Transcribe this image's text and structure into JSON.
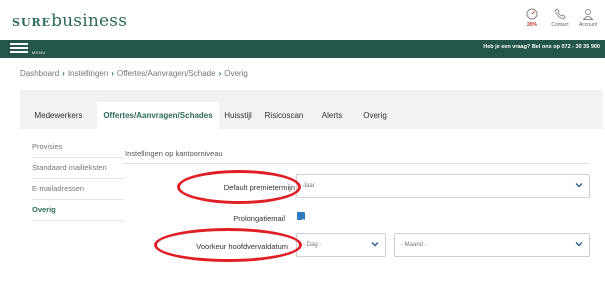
{
  "app": {
    "logo_prefix": "SURE",
    "logo_suffix": "business"
  },
  "toolbar": {
    "alerts": {
      "icon": "gauge-icon",
      "count": "20%"
    },
    "contact": {
      "icon": "phone-icon",
      "label": "Contact"
    },
    "account": {
      "icon": "user-icon",
      "label": "Account"
    }
  },
  "navbar": {
    "menu_label": "MENU",
    "help_text": "Heb je een vraag? Bel ons op 072 - 30 35 900"
  },
  "breadcrumb": [
    "Dashboard",
    "Instellingen",
    "Offertes/Aanvragen/Schade",
    "Overig"
  ],
  "tabs": [
    {
      "label": "Medewerkers",
      "active": false
    },
    {
      "label": "Offertes/Aanvragen/Schades",
      "active": true
    },
    {
      "label": "Huisstijl",
      "active": false
    },
    {
      "label": "Risicoscan",
      "active": false
    },
    {
      "label": "Alerts",
      "active": false
    },
    {
      "label": "Overig",
      "active": false
    }
  ],
  "sidebar": {
    "items": [
      {
        "label": "Provisies",
        "active": false
      },
      {
        "label": "Standaard mailteksten",
        "active": false
      },
      {
        "label": "E-mailadressen",
        "active": false
      },
      {
        "label": "Overig",
        "active": true
      }
    ]
  },
  "form": {
    "section_title": "Instellingen op kantoorniveau",
    "premietermijn": {
      "label": "Default premietermijn",
      "value": "Jaar"
    },
    "prolongatiemail": {
      "label": "Prolongatiemail",
      "checked": true
    },
    "hoofdvervaldatum": {
      "label": "Voorkeur hoofdvervaldatum",
      "day_value": "- Dag -",
      "month_value": "- Maand -"
    }
  },
  "colors": {
    "brand": "#2e6b5a",
    "navbar": "#23554a",
    "highlight": "#e01e25",
    "checkbox": "#2e7bc4"
  }
}
